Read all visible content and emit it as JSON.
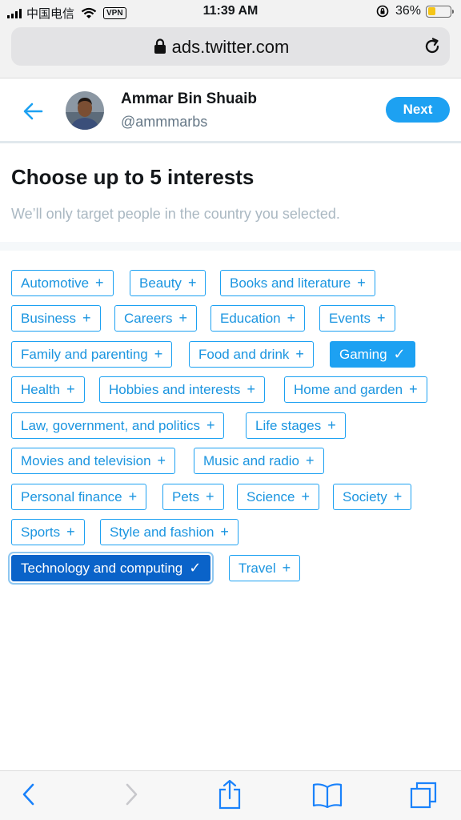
{
  "status_bar": {
    "carrier": "中国电信",
    "vpn_label": "VPN",
    "time": "11:39 AM",
    "battery_text": "36%",
    "battery_level": 0.36
  },
  "browser": {
    "url": "ads.twitter.com"
  },
  "header": {
    "name": "Ammar Bin Shuaib",
    "handle": "@ammmarbs",
    "next_label": "Next"
  },
  "main": {
    "title": "Choose up to 5 interests",
    "subtitle": "We’ll only target people in the country you selected."
  },
  "interests": [
    {
      "label": "Automotive",
      "symbol": "+",
      "selected": false
    },
    {
      "label": "Beauty",
      "symbol": "+",
      "selected": false
    },
    {
      "label": "Books and literature",
      "symbol": "+",
      "selected": false
    },
    {
      "label": "Business",
      "symbol": "+",
      "selected": false
    },
    {
      "label": "Careers",
      "symbol": "+",
      "selected": false
    },
    {
      "label": "Education",
      "symbol": "+",
      "selected": false
    },
    {
      "label": "Events",
      "symbol": "+",
      "selected": false
    },
    {
      "label": "Family and parenting",
      "symbol": "+",
      "selected": false
    },
    {
      "label": "Food and drink",
      "symbol": "+",
      "selected": false
    },
    {
      "label": "Gaming",
      "symbol": "✓",
      "selected": true
    },
    {
      "label": "Health",
      "symbol": "+",
      "selected": false
    },
    {
      "label": "Hobbies and interests",
      "symbol": "+",
      "selected": false
    },
    {
      "label": "Home and garden",
      "symbol": "+",
      "selected": false
    },
    {
      "label": "Law, government, and politics",
      "symbol": "+",
      "selected": false
    },
    {
      "label": "Life stages",
      "symbol": "+",
      "selected": false
    },
    {
      "label": "Movies and television",
      "symbol": "+",
      "selected": false
    },
    {
      "label": "Music and radio",
      "symbol": "+",
      "selected": false
    },
    {
      "label": "Personal finance",
      "symbol": "+",
      "selected": false
    },
    {
      "label": "Pets",
      "symbol": "+",
      "selected": false
    },
    {
      "label": "Science",
      "symbol": "+",
      "selected": false
    },
    {
      "label": "Society",
      "symbol": "+",
      "selected": false
    },
    {
      "label": "Sports",
      "symbol": "+",
      "selected": false
    },
    {
      "label": "Style and fashion",
      "symbol": "+",
      "selected": false
    },
    {
      "label": "Technology and computing",
      "symbol": "✓",
      "selected": true,
      "focused": true
    },
    {
      "label": "Travel",
      "symbol": "+",
      "selected": false
    }
  ],
  "toolbar": {
    "icons": [
      "back-icon",
      "forward-icon",
      "share-icon",
      "bookmarks-icon",
      "tabs-icon"
    ]
  },
  "colors": {
    "accent": "#1da1f2",
    "chip_text": "#1b95e0",
    "selected_focus": "#0a63c9",
    "muted_text": "#aab8c2"
  }
}
